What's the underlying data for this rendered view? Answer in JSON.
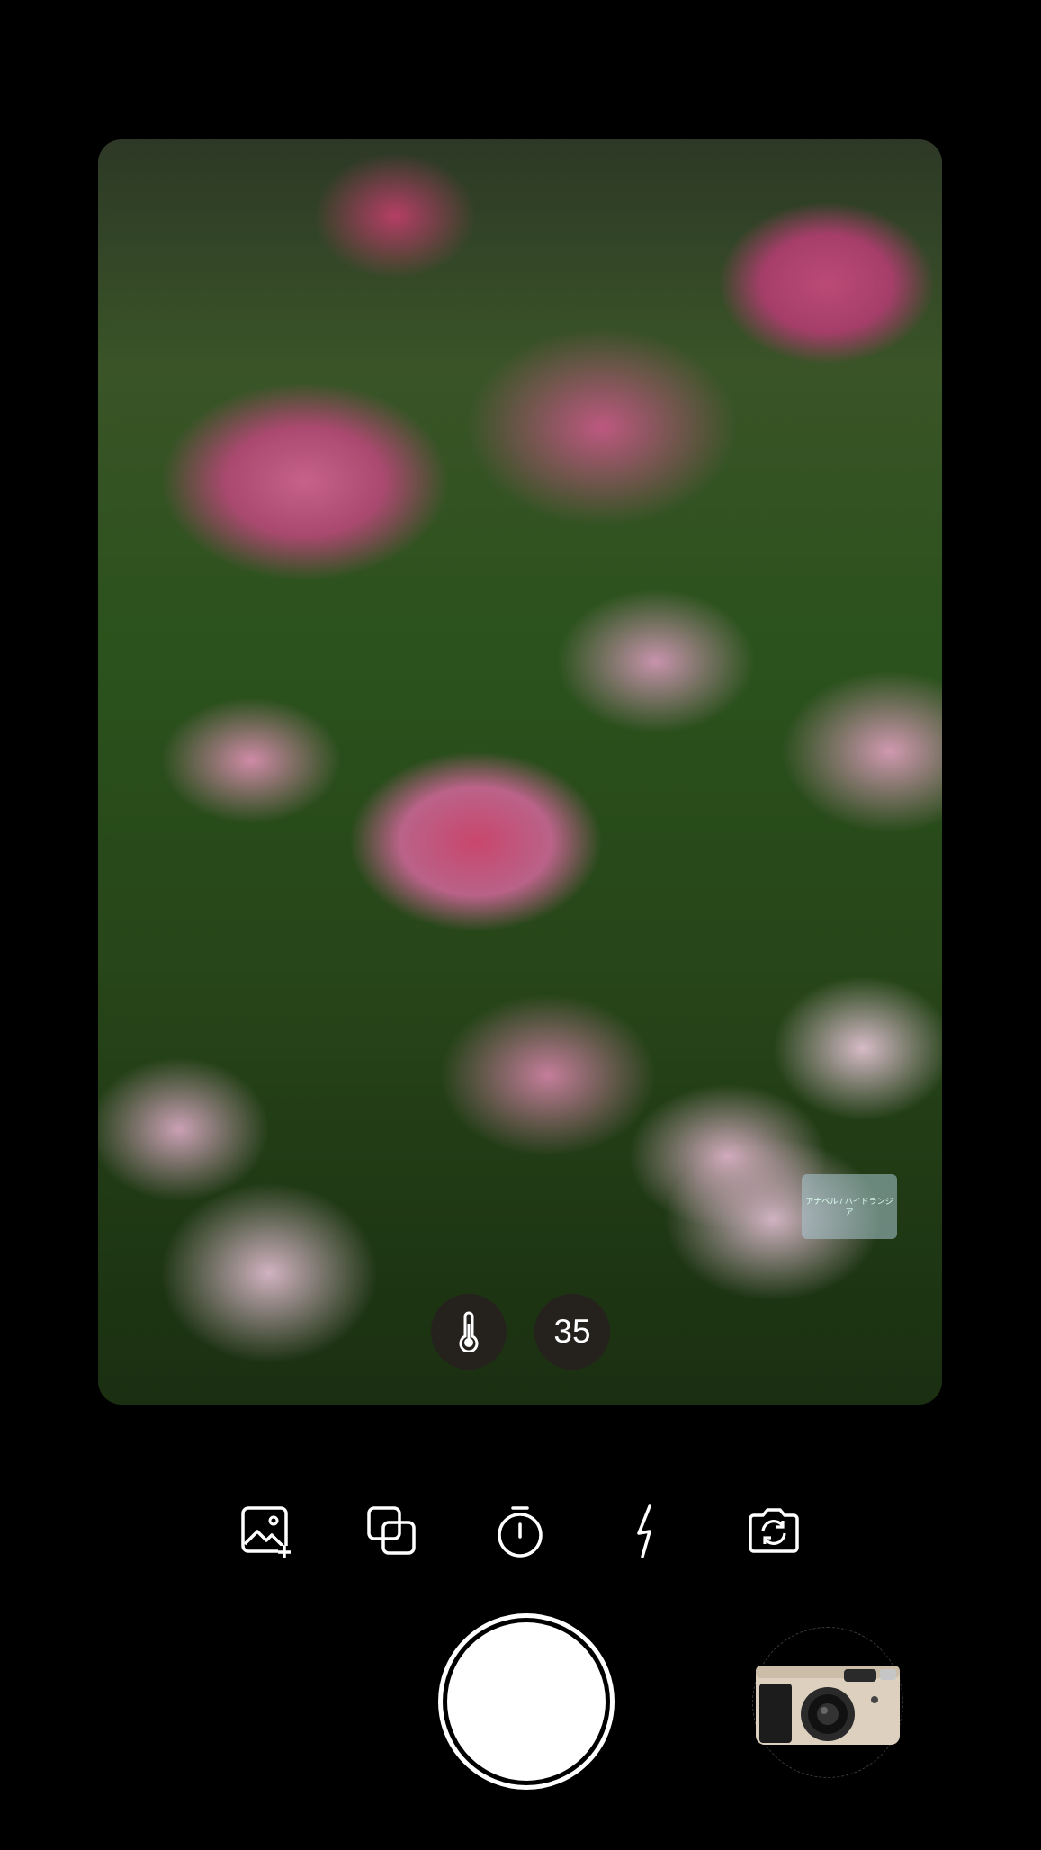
{
  "viewfinder": {
    "plant_label_text": "アナベル / ハイドランジア",
    "temperature_icon": "thermometer-icon",
    "zoom_value": "35"
  },
  "toolbar": {
    "items": [
      {
        "name": "gallery-add",
        "icon": "image-plus-icon"
      },
      {
        "name": "overlay",
        "icon": "layers-icon"
      },
      {
        "name": "timer",
        "icon": "timer-icon"
      },
      {
        "name": "flash",
        "icon": "flash-icon"
      },
      {
        "name": "switch-camera",
        "icon": "camera-flip-icon"
      }
    ]
  },
  "shutter": {
    "icon": "shutter-button"
  },
  "camera_selector": {
    "icon": "film-camera-icon",
    "body_color": "#d9cbb8",
    "accent": "#1b1b1b"
  }
}
